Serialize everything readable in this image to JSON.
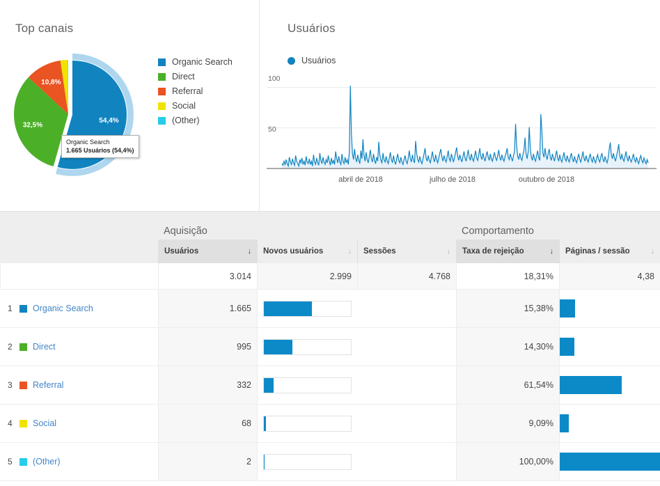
{
  "colors": {
    "organic": "#1184c0",
    "direct": "#4caf28",
    "referral": "#ea5322",
    "social": "#f1e300",
    "other": "#28ccea",
    "bar": "#0c8ac8",
    "highlight": "#aed6ee",
    "line": "#1184c0",
    "line_fill": "#e7f2fa"
  },
  "pie_panel": {
    "title": "Top canais",
    "legend": [
      {
        "label": "Organic Search",
        "color": "#1184c0"
      },
      {
        "label": "Direct",
        "color": "#4caf28"
      },
      {
        "label": "Referral",
        "color": "#ea5322"
      },
      {
        "label": "Social",
        "color": "#f1e300"
      },
      {
        "label": "(Other)",
        "color": "#28ccea"
      }
    ],
    "tooltip": {
      "title": "Organic Search",
      "value": "1.665 Usuários (54,4%)"
    }
  },
  "line_panel": {
    "title": "Usuários",
    "legend_label": "Usuários",
    "y_ticks": [
      "100",
      "50"
    ],
    "x_labels": [
      "abril de 2018",
      "julho de 2018",
      "outubro de 2018"
    ]
  },
  "table": {
    "groups": [
      {
        "label": "Aquisição"
      },
      {
        "label": "Comportamento"
      }
    ],
    "columns": [
      {
        "label": "Usuários",
        "sorted": true
      },
      {
        "label": "Novos usuários",
        "sorted": false
      },
      {
        "label": "Sessões",
        "sorted": false
      },
      {
        "label": "Taxa de rejeição",
        "sorted": true
      },
      {
        "label": "Páginas / sessão",
        "sorted": false
      }
    ],
    "sort_arrow": "↓",
    "totals": {
      "users": "3.014",
      "new_users": "2.999",
      "sessions": "4.768",
      "bounce": "18,31%",
      "pages": "4,38"
    },
    "rows": [
      {
        "rank": "1",
        "label": "Organic Search",
        "color": "#1184c0",
        "users": "1.665",
        "users_pct": 55.2,
        "new_users_pct": 55.2,
        "bounce": "15,38%",
        "bounce_pct": 15.38
      },
      {
        "rank": "2",
        "label": "Direct",
        "color": "#4caf28",
        "users": "995",
        "users_pct": 33.0,
        "new_users_pct": 33.0,
        "bounce": "14,30%",
        "bounce_pct": 14.3
      },
      {
        "rank": "3",
        "label": "Referral",
        "color": "#ea5322",
        "users": "332",
        "users_pct": 11.0,
        "new_users_pct": 11.0,
        "bounce": "61,54%",
        "bounce_pct": 61.54
      },
      {
        "rank": "4",
        "label": "Social",
        "color": "#f1e300",
        "users": "68",
        "users_pct": 2.3,
        "new_users_pct": 2.3,
        "bounce": "9,09%",
        "bounce_pct": 9.09
      },
      {
        "rank": "5",
        "label": "(Other)",
        "color": "#28ccea",
        "users": "2",
        "users_pct": 0.4,
        "new_users_pct": 0.4,
        "bounce": "100,00%",
        "bounce_pct": 100.0
      }
    ]
  },
  "chart_data": [
    {
      "type": "pie",
      "title": "Top canais",
      "labels": [
        "Organic Search",
        "Direct",
        "Referral",
        "Social",
        "(Other)"
      ],
      "values": [
        1665,
        995,
        332,
        68,
        2
      ],
      "percentages": [
        54.4,
        32.5,
        10.8,
        2.2,
        0.1
      ],
      "shown_labels": [
        "54,4%",
        "32,5%",
        "10,8%",
        "",
        ""
      ],
      "colors": [
        "#1184c0",
        "#4caf28",
        "#ea5322",
        "#f1e300",
        "#28ccea"
      ],
      "metric": "Usuários",
      "exploded_slice": "Organic Search",
      "legend_position": "right"
    },
    {
      "type": "line",
      "title": "Usuários",
      "ylabel": "",
      "xlabel": "",
      "series_name": "Usuários",
      "ylim": [
        0,
        115
      ],
      "y_ticks": [
        50,
        100
      ],
      "grid": true,
      "x_tick_labels": [
        "abril de 2018",
        "julho de 2018",
        "outubro de 2018"
      ],
      "x_tick_positions": [
        0.25,
        0.51,
        0.745
      ],
      "values": [
        6,
        4,
        9,
        5,
        11,
        6,
        3,
        14,
        8,
        5,
        12,
        7,
        4,
        16,
        9,
        6,
        3,
        11,
        7,
        13,
        5,
        9,
        4,
        15,
        8,
        6,
        12,
        5,
        9,
        3,
        17,
        8,
        5,
        13,
        7,
        4,
        19,
        10,
        6,
        14,
        8,
        5,
        11,
        7,
        16,
        9,
        4,
        13,
        6,
        10,
        5,
        21,
        12,
        7,
        15,
        8,
        5,
        18,
        9,
        6,
        14,
        7,
        11,
        5,
        20,
        102,
        43,
        18,
        11,
        24,
        13,
        8,
        17,
        10,
        6,
        22,
        12,
        36,
        16,
        9,
        20,
        11,
        7,
        15,
        23,
        12,
        8,
        18,
        10,
        6,
        14,
        9,
        33,
        17,
        10,
        7,
        19,
        11,
        8,
        15,
        9,
        6,
        13,
        20,
        11,
        7,
        16,
        9,
        5,
        12,
        18,
        10,
        7,
        14,
        8,
        5,
        11,
        16,
        9,
        6,
        13,
        22,
        12,
        8,
        17,
        10,
        7,
        34,
        19,
        11,
        8,
        15,
        9,
        6,
        12,
        18,
        25,
        13,
        9,
        16,
        10,
        7,
        14,
        21,
        12,
        8,
        17,
        11,
        7,
        13,
        19,
        24,
        14,
        9,
        16,
        11,
        8,
        15,
        22,
        12,
        9,
        18,
        13,
        8,
        14,
        20,
        26,
        15,
        10,
        17,
        12,
        8,
        15,
        21,
        13,
        9,
        16,
        23,
        14,
        10,
        18,
        12,
        9,
        15,
        22,
        13,
        10,
        17,
        25,
        15,
        11,
        19,
        13,
        9,
        16,
        21,
        14,
        10,
        18,
        12,
        9,
        15,
        20,
        13,
        10,
        16,
        23,
        14,
        10,
        17,
        12,
        9,
        15,
        19,
        25,
        14,
        11,
        18,
        13,
        9,
        16,
        21,
        55,
        28,
        15,
        11,
        19,
        13,
        10,
        17,
        23,
        38,
        18,
        12,
        21,
        51,
        25,
        14,
        10,
        18,
        12,
        9,
        16,
        22,
        13,
        10,
        67,
        46,
        19,
        14,
        25,
        16,
        11,
        19,
        24,
        14,
        10,
        18,
        13,
        9,
        16,
        22,
        13,
        9,
        17,
        11,
        8,
        14,
        20,
        12,
        9,
        16,
        11,
        8,
        14,
        19,
        12,
        8,
        15,
        10,
        7,
        13,
        18,
        11,
        8,
        14,
        21,
        13,
        9,
        16,
        11,
        8,
        14,
        18,
        11,
        8,
        15,
        10,
        7,
        13,
        17,
        11,
        8,
        14,
        19,
        12,
        8,
        15,
        10,
        7,
        13,
        24,
        32,
        17,
        12,
        19,
        13,
        9,
        16,
        22,
        30,
        16,
        11,
        18,
        12,
        9,
        15,
        21,
        13,
        9,
        16,
        11,
        8,
        13,
        18,
        11,
        8,
        14,
        9,
        6,
        12,
        16,
        10,
        7,
        13,
        9,
        6,
        11,
        7
      ]
    }
  ]
}
